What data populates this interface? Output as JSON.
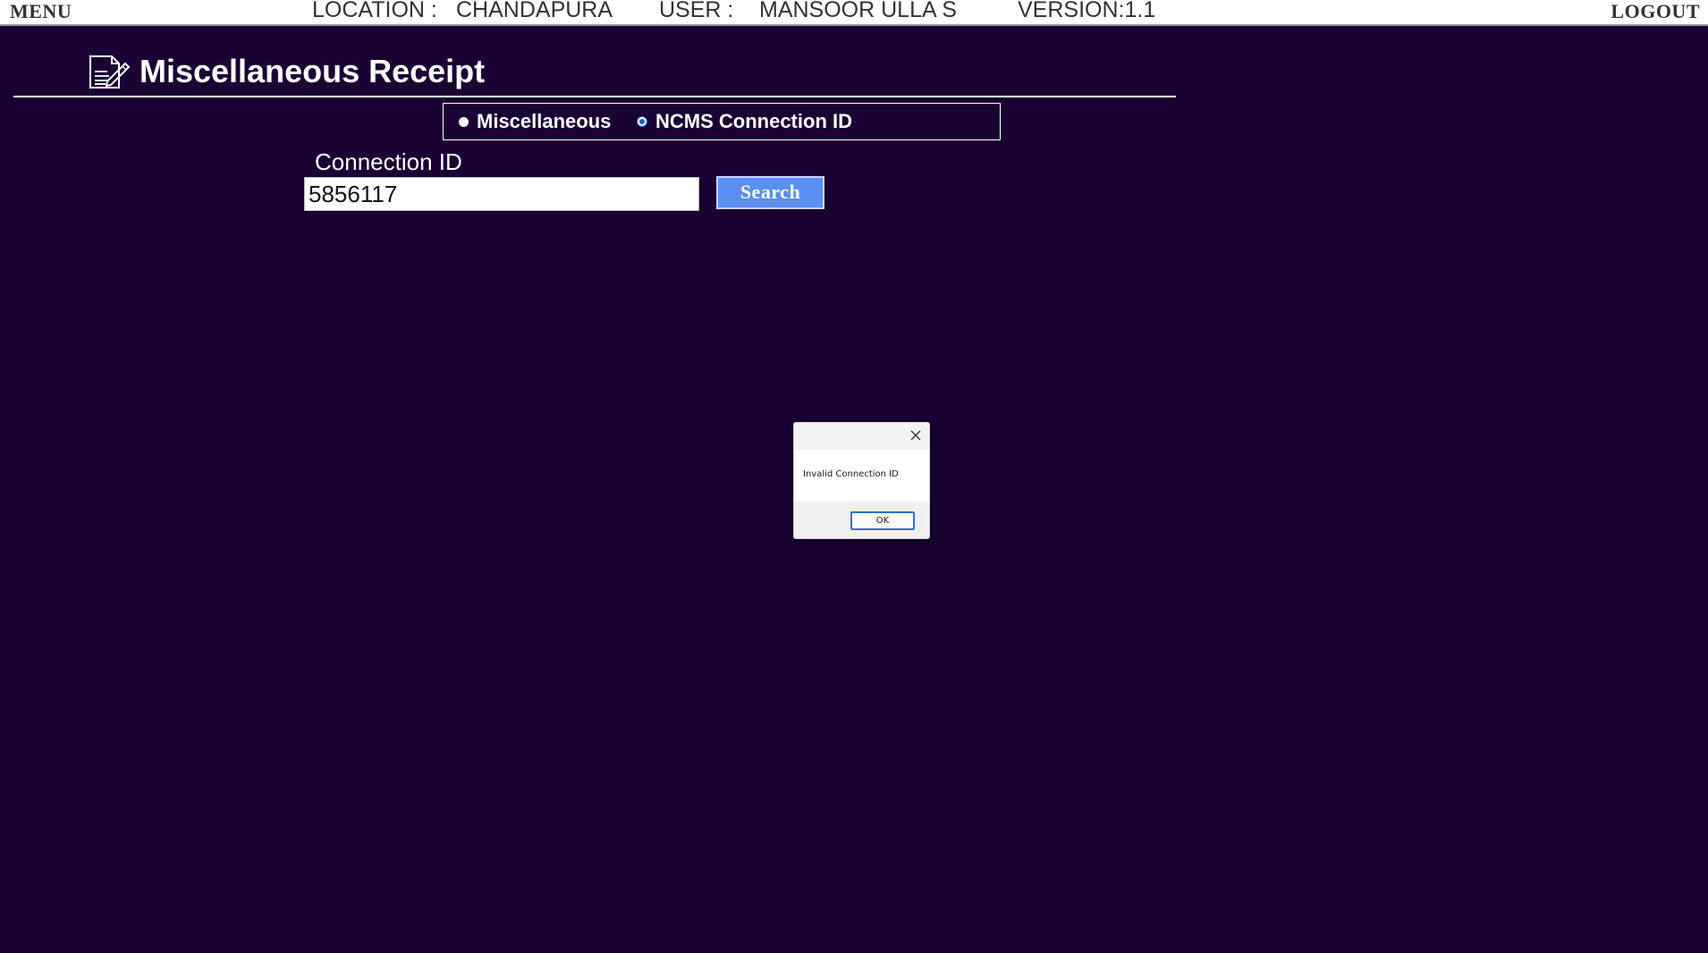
{
  "header": {
    "menu_label": "MENU",
    "location_label": "LOCATION :",
    "location_value": "CHANDAPURA",
    "user_label": "USER :",
    "user_value": "MANSOOR ULLA S",
    "version_label": "VERSION:1.1",
    "logout_label": "LOGOUT"
  },
  "page": {
    "title": "Miscellaneous Receipt",
    "title_icon": "document-edit-icon"
  },
  "mode": {
    "options": [
      {
        "label": "Miscellaneous",
        "checked": false
      },
      {
        "label": "NCMS Connection ID",
        "checked": true
      }
    ]
  },
  "form": {
    "connection_label": "Connection ID",
    "connection_value": "5856117",
    "search_label": "Search"
  },
  "dialog": {
    "message": "Invalid Connection ID",
    "ok_label": "OK",
    "close_icon": "close-icon"
  },
  "colors": {
    "background": "#1a0033",
    "header_bg": "#ffffff",
    "search_button": "#5b8ff0",
    "dialog_ok_border": "#2f6fd6"
  }
}
